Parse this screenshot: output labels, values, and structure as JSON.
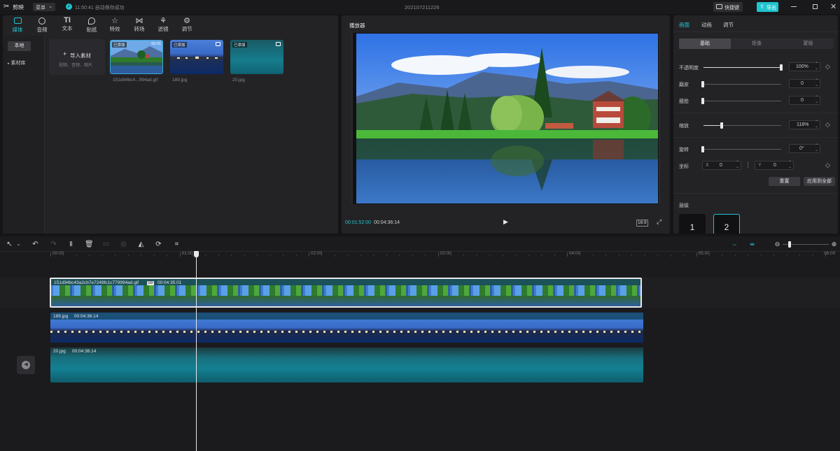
{
  "app": {
    "name": "剪映",
    "menu_label": "菜单",
    "save_status": "11:50:41 自动保存成功",
    "project_title": "202107211226",
    "shortcut_label": "快捷键",
    "export_label": "导出"
  },
  "media_tabs": [
    {
      "label": "媒体",
      "icon": "media-icon",
      "active": true
    },
    {
      "label": "音频",
      "icon": "audio-icon"
    },
    {
      "label": "文本",
      "icon": "text-icon"
    },
    {
      "label": "贴纸",
      "icon": "sticker-icon"
    },
    {
      "label": "特效",
      "icon": "effects-icon"
    },
    {
      "label": "转场",
      "icon": "transition-icon"
    },
    {
      "label": "滤镜",
      "icon": "filter-icon"
    },
    {
      "label": "调节",
      "icon": "adjust-icon"
    }
  ],
  "sidebar": {
    "local": "本地",
    "library": "素材库"
  },
  "import": {
    "label": "导入素材",
    "hint": "视频、音频、图片"
  },
  "media_items": [
    {
      "name": "151d94bc4...994ad.gif",
      "badge": "已添加",
      "duration": "00:01"
    },
    {
      "name": "189.jpg",
      "badge": "已添加"
    },
    {
      "name": "20.jpg",
      "badge": "已添加"
    }
  ],
  "player": {
    "title": "播放器",
    "current_time": "00:01:52:00",
    "total_time": "00:04:36:14",
    "aspect": "16:9"
  },
  "inspector": {
    "tabs": [
      "画面",
      "动画",
      "调节"
    ],
    "subtabs": [
      "基础",
      "抠像",
      "蒙版"
    ],
    "opacity": {
      "label": "不透明度",
      "value": "100%",
      "level": 1.0
    },
    "smooth": {
      "label": "磨皮",
      "value": "0",
      "level": 0.0
    },
    "slim": {
      "label": "瘦脸",
      "value": "0",
      "level": 0.0
    },
    "scale": {
      "label": "缩放",
      "value": "118%",
      "level": 0.24
    },
    "rotate": {
      "label": "旋转",
      "value": "0°",
      "level": 0.0
    },
    "position": {
      "label": "坐标",
      "x_label": "X",
      "x": "0",
      "y_label": "Y",
      "y": "0"
    },
    "reset_label": "重置",
    "apply_all_label": "应用到全部",
    "layer_label": "层级",
    "layers": [
      "1",
      "2"
    ]
  },
  "ruler": [
    "00:00",
    "01:00",
    "02:00",
    "03:00",
    "04:00",
    "05:00",
    "06:00"
  ],
  "playhead_time_fraction": 0.1876,
  "tracks": [
    {
      "name": "151d94bc43a2cb7e7249fc1c779994ad.gif",
      "tag": "GIF",
      "duration": "00:04:35:01"
    },
    {
      "name": "189.jpg",
      "duration": "00:04:36:14"
    },
    {
      "name": "20.jpg",
      "duration": "00:04:36:14"
    }
  ],
  "colors": {
    "accent": "#20c4cf",
    "panel": "#232326",
    "bg": "#151517"
  }
}
